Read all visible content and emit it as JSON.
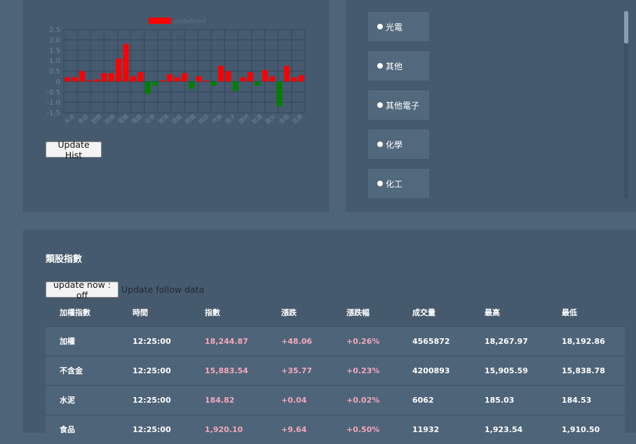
{
  "chart_data": {
    "type": "bar",
    "legend": {
      "label": "undefined",
      "color": "#ff0000",
      "placement": "top"
    },
    "ylim": [
      -1.5,
      2.5
    ],
    "yticks": [
      "2.5",
      "2.0",
      "1.5",
      "1.0",
      "0.5",
      "0",
      "-0.5",
      "-1.0",
      "-1.5"
    ],
    "ytick_values": [
      2.5,
      2.0,
      1.5,
      1.0,
      0.5,
      0,
      -0.5,
      -1.0,
      -1.5
    ],
    "xtick_labels": [
      "水泥",
      "食品",
      "塑膠",
      "紡織",
      "電機",
      "電器",
      "化學",
      "玻璃",
      "造紙",
      "鋼鐵",
      "橡膠",
      "汽車",
      "電子",
      "建材",
      "航運",
      "觀光",
      "金融",
      "百貨"
    ],
    "values": [
      0.2,
      0.2,
      0.5,
      0.05,
      0.1,
      0.4,
      0.4,
      1.1,
      1.8,
      0.25,
      0.45,
      -0.6,
      -0.2,
      0.05,
      0.35,
      0.2,
      0.4,
      -0.35,
      0.25,
      0.05,
      -0.2,
      0.75,
      0.5,
      -0.45,
      0.2,
      0.45,
      -0.2,
      0.55,
      0.25,
      -1.2,
      0.75,
      0.2,
      0.3
    ],
    "positive_color": "#ff0000",
    "negative_color": "#008000",
    "grid": true
  },
  "chart_panel": {
    "update_hist_label": "Update Hist"
  },
  "radio_list": {
    "items": [
      "光電",
      "其他",
      "其他電子",
      "化學",
      "化工"
    ]
  },
  "index_section": {
    "title": "類股指數",
    "update_now_label": "update now : off",
    "update_follow_label": "Update follow data",
    "columns": [
      "加權指數",
      "時間",
      "指數",
      "漲跌",
      "漲跌幅",
      "成交量",
      "最高",
      "最低"
    ],
    "rows": [
      [
        "加權",
        "12:25:00",
        "18,244.87",
        "+48.06",
        "+0.26%",
        "4565872",
        "18,267.97",
        "18,192.86"
      ],
      [
        "不含金",
        "12:25:00",
        "15,883.54",
        "+35.77",
        "+0.23%",
        "4200893",
        "15,905.59",
        "15,838.78"
      ],
      [
        "水泥",
        "12:25:00",
        "184.82",
        "+0.04",
        "+0.02%",
        "6062",
        "185.03",
        "184.53"
      ],
      [
        "食品",
        "12:25:00",
        "1,920.10",
        "+9.64",
        "+0.50%",
        "11932",
        "1,923.54",
        "1,910.50"
      ]
    ]
  }
}
